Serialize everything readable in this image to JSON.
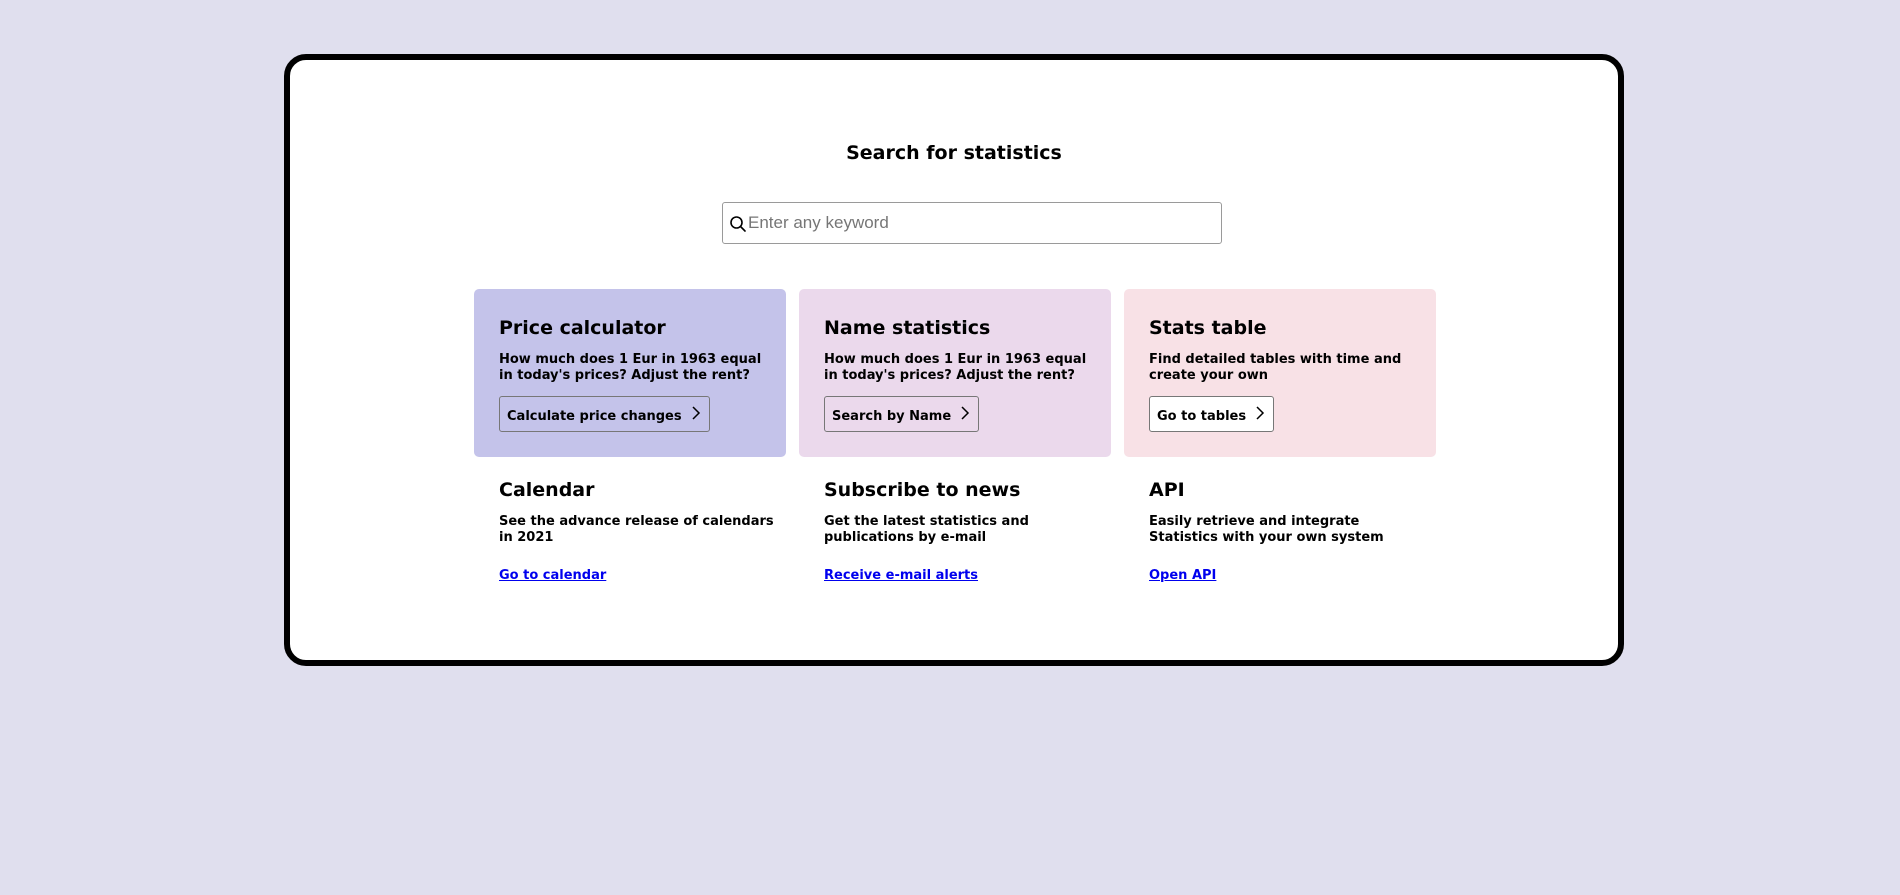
{
  "page": {
    "title": "Search for statistics"
  },
  "search": {
    "icon": "search-icon",
    "placeholder": "Enter any keyword",
    "value": ""
  },
  "cards": [
    {
      "title": "Price calculator",
      "description": "How much does 1 Eur in 1963 equal in today's prices? Adjust the rent?",
      "button_label": "Calculate price changes",
      "button_icon": "chevron-right-icon",
      "background": "#c4c3ea"
    },
    {
      "title": "Name statistics",
      "description": "How much does 1 Eur in 1963 equal in today's prices? Adjust the rent?",
      "button_label": "Search by Name",
      "button_icon": "chevron-right-icon",
      "background": "#ebd9ec"
    },
    {
      "title": "Stats table",
      "description": "Find detailed tables with time and create your own",
      "button_label": "Go to tables",
      "button_icon": "chevron-right-icon",
      "background": "#f8e1e6"
    }
  ],
  "info_sections": [
    {
      "title": "Calendar",
      "description": "See the advance release of calendars in 2021",
      "link_label": "Go to calendar"
    },
    {
      "title": "Subscribe to news",
      "description": "Get the latest statistics and publications by e-mail",
      "link_label": "Receive e-mail alerts"
    },
    {
      "title": "API",
      "description": "Easily retrieve and integrate Statistics with your own system",
      "link_label": "Open API"
    }
  ],
  "colors": {
    "page_background": "#e0dfee",
    "frame_border": "#000000",
    "link": "#0000ee"
  }
}
